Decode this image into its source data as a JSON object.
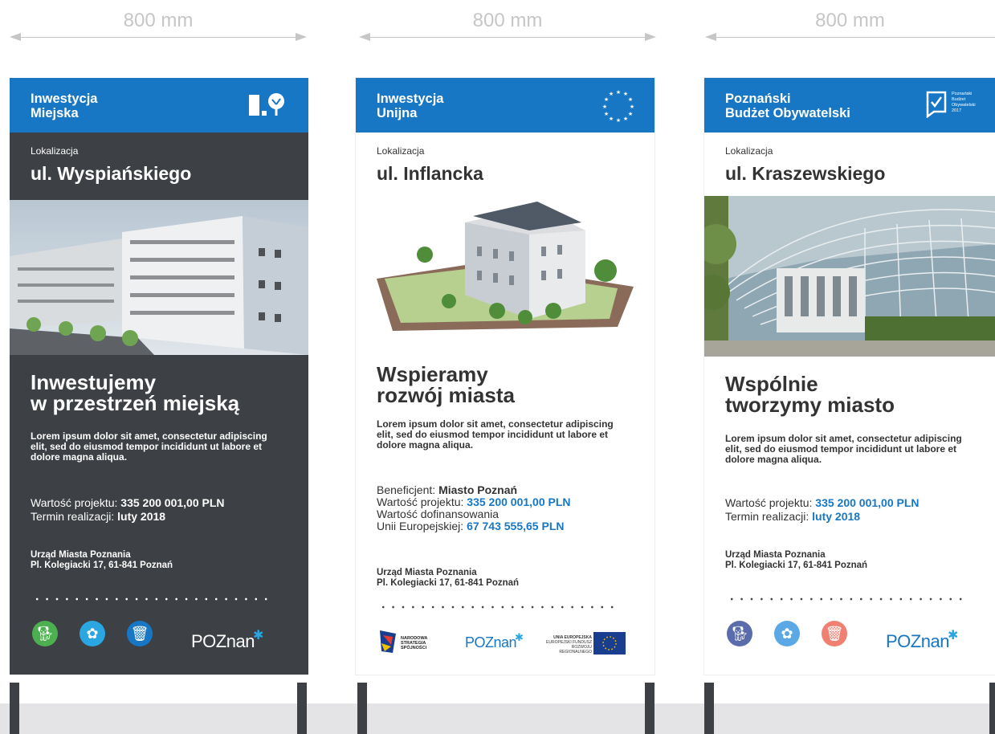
{
  "dimension_label": "800 mm",
  "signs": [
    {
      "header": [
        "Inwestycja",
        "Miejska"
      ],
      "location_label": "Lokalizacja",
      "location": "ul. Wyspiańskiego",
      "headline": [
        "Inwestujemy",
        "w przestrzeń miejską"
      ],
      "lorem": "Lorem ipsum dolor sit amet, consectetur adipiscing elit, sed do eiusmod tempor incididunt ut labore et dolore magna aliqua.",
      "value_label": "Wartość projektu: ",
      "value": "335 200 001,00 PLN",
      "term_label": "Termin realizacji: ",
      "term": "luty 2018",
      "office": "Urząd Miasta Poznania",
      "address": "Pl. Kolegiacki 17, 61-841 Poznań",
      "logo": "POZnan",
      "icons": [
        "dog-icon",
        "tulip-icon",
        "trash-bin-icon"
      ],
      "icon_colors": [
        "#4caf50",
        "#2aa6e0",
        "#1777c4"
      ]
    },
    {
      "header": [
        "Inwestycja",
        "Unijna"
      ],
      "location_label": "Lokalizacja",
      "location": "ul. Inflancka",
      "headline": [
        "Wspieramy",
        "rozwój miasta"
      ],
      "lorem": "Lorem ipsum dolor sit amet, consectetur adipiscing elit, sed do eiusmod tempor incididunt ut labore et dolore magna aliqua.",
      "beneficiary_label": "Beneficjent: ",
      "beneficiary": "Miasto Poznań",
      "value_label": "Wartość projektu: ",
      "value": "335 200 001,00 PLN",
      "cofinance_label_1": "Wartość dofinansowania",
      "cofinance_label_2": "Unii Europejskiej: ",
      "cofinance": "67 743 555,65 PLN",
      "office": "Urząd Miasta Poznania",
      "address": "Pl. Kolegiacki 17, 61-841 Poznań",
      "logo": "POZnan",
      "eu_logo_1": [
        "NARODOWA",
        "STRATEGIA SPÓJNOŚCI"
      ],
      "eu_logo_2": [
        "UNIA EUROPEJSKA",
        "EUROPEJSKI FUNDUSZ",
        "ROZWOJU REGIONALNEGO"
      ]
    },
    {
      "header": [
        "Poznański",
        "Budżet Obywatelski"
      ],
      "badge": [
        "Poznański",
        "Budżet",
        "Obywatelski",
        "2017"
      ],
      "location_label": "Lokalizacja",
      "location": "ul. Kraszewskiego",
      "headline": [
        "Wspólnie",
        "tworzymy miasto"
      ],
      "lorem": "Lorem ipsum dolor sit amet, consectetur adipiscing elit, sed do eiusmod tempor incididunt ut labore et dolore magna aliqua.",
      "value_label": "Wartość projektu: ",
      "value": "335 200 001,00 PLN",
      "term_label": "Termin realizacji: ",
      "term": "luty 2018",
      "office": "Urząd Miasta Poznania",
      "address": "Pl. Kolegiacki 17, 61-841 Poznań",
      "logo": "POZnan",
      "icons": [
        "dog-icon",
        "tulip-icon",
        "trash-bin-icon"
      ],
      "icon_colors": [
        "#5b6cad",
        "#5aa9e6",
        "#f08072"
      ]
    }
  ],
  "colors": {
    "brand_blue": "#1777c4",
    "dark_panel": "#3d4045"
  }
}
